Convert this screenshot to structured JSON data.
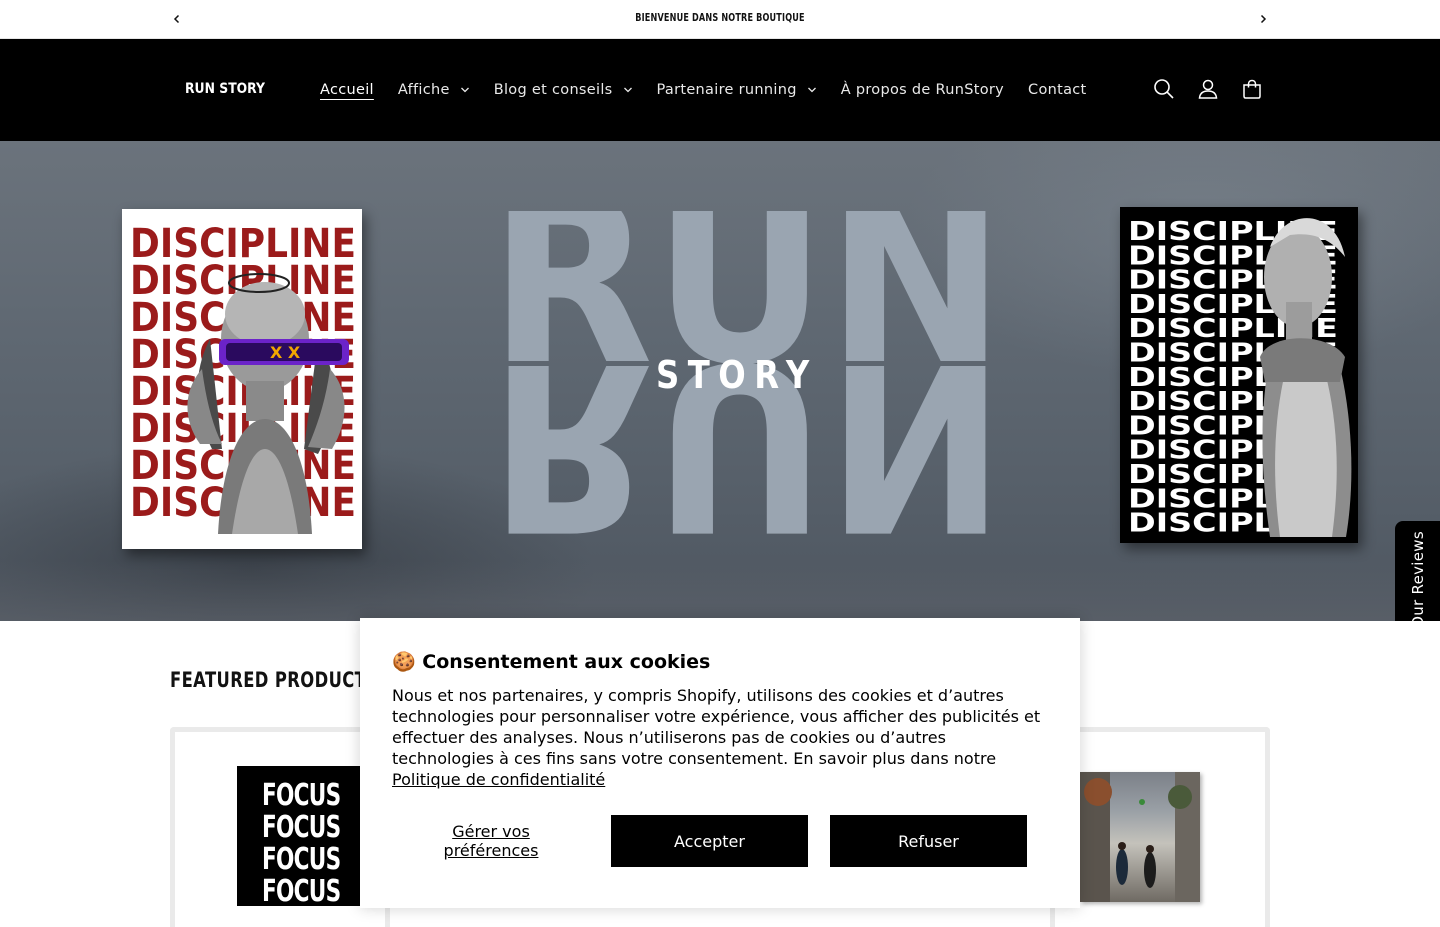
{
  "announcement": {
    "message": "BIENVENUE DANS NOTRE BOUTIQUE"
  },
  "header": {
    "logo_text": "RUN STORY",
    "nav": [
      {
        "label": "Accueil",
        "active": true,
        "dropdown": false
      },
      {
        "label": "Affiche",
        "active": false,
        "dropdown": true
      },
      {
        "label": "Blog et conseils",
        "active": false,
        "dropdown": true
      },
      {
        "label": "Partenaire running",
        "active": false,
        "dropdown": true
      },
      {
        "label": "À propos de RunStory",
        "active": false,
        "dropdown": false
      },
      {
        "label": "Contact",
        "active": false,
        "dropdown": false
      }
    ],
    "icons": [
      "search-icon",
      "account-icon",
      "cart-icon"
    ]
  },
  "hero": {
    "big_word": "RUN",
    "sub_word": "STORY",
    "left_poster_word": "DISCIPLINE",
    "right_poster_word": "DISCIPLINE"
  },
  "reviews_tab": {
    "label": "Our Reviews",
    "star": "⭐"
  },
  "featured": {
    "title": "FEATURED PRODUCTS",
    "focus_word": "FOCUS"
  },
  "cookie": {
    "emoji": "🍪",
    "title": "Consentement aux cookies",
    "body": "Nous et nos partenaires, y compris Shopify, utilisons des cookies et d’autres technologies pour personnaliser votre expérience, vous afficher des publicités et effectuer des analyses. Nous n’utiliserons pas de cookies ou d’autres technologies à ces fins sans votre consentement. En savoir plus dans notre ",
    "policy_link": "Politique de confidentialité",
    "manage": "Gérer vos préférences",
    "accept": "Accepter",
    "refuse": "Refuser"
  },
  "colors": {
    "header_bg": "#000000",
    "poster_red": "#9b1b1b",
    "run_letters": "#9aa5b1"
  }
}
